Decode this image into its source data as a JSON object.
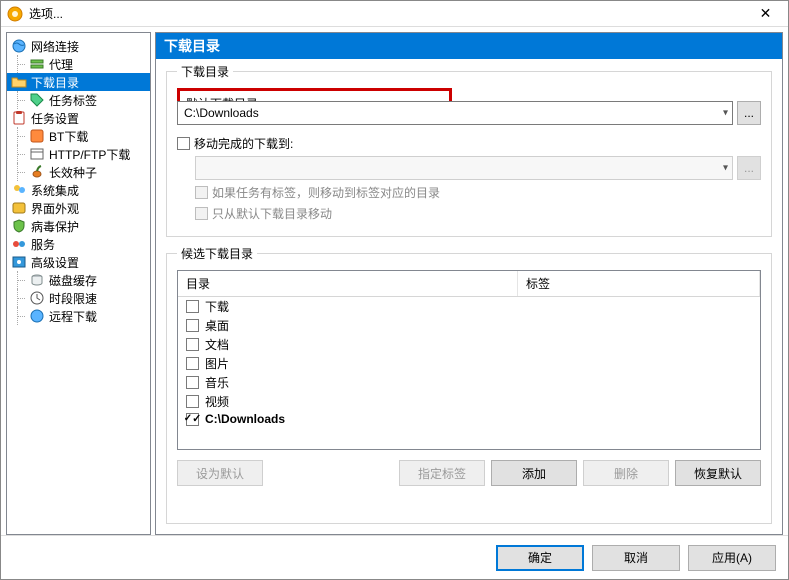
{
  "window": {
    "title": "选项..."
  },
  "sidebar": {
    "items": [
      {
        "label": "网络连接",
        "icon": "globe",
        "children": [
          {
            "label": "代理",
            "icon": "proxy"
          }
        ]
      },
      {
        "label": "下载目录",
        "icon": "folder-open",
        "selected": true,
        "children": [
          {
            "label": "任务标签",
            "icon": "tag"
          }
        ]
      },
      {
        "label": "任务设置",
        "icon": "clipboard",
        "children": [
          {
            "label": "BT下载",
            "icon": "bt"
          },
          {
            "label": "HTTP/FTP下载",
            "icon": "http"
          },
          {
            "label": "长效种子",
            "icon": "seed"
          }
        ]
      },
      {
        "label": "系统集成",
        "icon": "users"
      },
      {
        "label": "界面外观",
        "icon": "palette"
      },
      {
        "label": "病毒保护",
        "icon": "shield"
      },
      {
        "label": "服务",
        "icon": "services"
      },
      {
        "label": "高级设置",
        "icon": "advanced",
        "children": [
          {
            "label": "磁盘缓存",
            "icon": "disk"
          },
          {
            "label": "时段限速",
            "icon": "clock"
          },
          {
            "label": "远程下载",
            "icon": "remote"
          }
        ]
      }
    ]
  },
  "panel": {
    "header": "下载目录",
    "group1": {
      "legend": "下载目录",
      "default_label": "默认下载目录:",
      "default_value": "C:\\Downloads",
      "move_chk_label": "移动完成的下载到:",
      "move_value": "",
      "sub1": "如果任务有标签，则移动到标签对应的目录",
      "sub2": "只从默认下载目录移动"
    },
    "group2": {
      "legend": "候选下载目录",
      "col_dir": "目录",
      "col_tag": "标签",
      "rows": [
        {
          "label": "下载",
          "checked": false
        },
        {
          "label": "桌面",
          "checked": false
        },
        {
          "label": "文档",
          "checked": false
        },
        {
          "label": "图片",
          "checked": false
        },
        {
          "label": "音乐",
          "checked": false
        },
        {
          "label": "视频",
          "checked": false
        },
        {
          "label": "C:\\Downloads",
          "checked": true,
          "bold": true
        }
      ],
      "buttons": {
        "set_default": "设为默认",
        "set_tag": "指定标签",
        "add": "添加",
        "delete": "删除",
        "restore": "恢复默认"
      }
    }
  },
  "dialog": {
    "ok": "确定",
    "cancel": "取消",
    "apply": "应用(A)"
  }
}
